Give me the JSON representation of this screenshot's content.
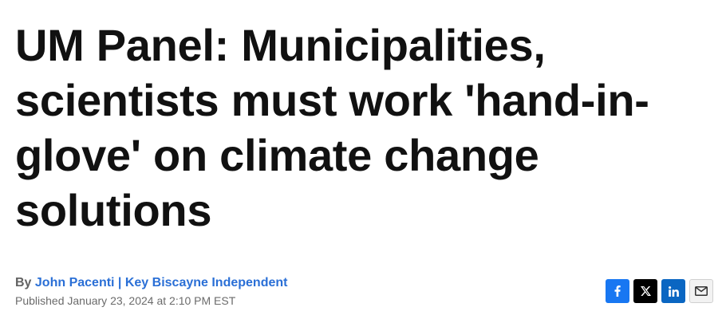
{
  "article": {
    "headline": "UM Panel: Municipalities, scientists must work 'hand-in-glove' on climate change solutions",
    "byline_prefix": "By ",
    "author": "John Pacenti | Key Biscayne Independent",
    "published": "Published January 23, 2024 at 2:10 PM EST"
  },
  "share": {
    "buttons": [
      {
        "icon": "facebook-icon",
        "color": "#1877f2"
      },
      {
        "icon": "x-icon",
        "color": "#000000"
      },
      {
        "icon": "linkedin-icon",
        "color": "#0a66c2"
      },
      {
        "icon": "email-icon",
        "color": "#f2f2f2"
      }
    ]
  },
  "colors": {
    "author_link": "#2a6fd6",
    "headline": "#111111",
    "meta_text": "#6b6b6b"
  }
}
